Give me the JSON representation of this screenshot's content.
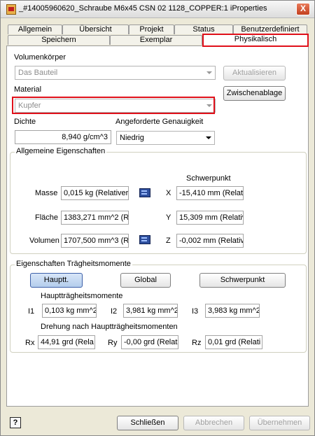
{
  "window": {
    "title": "_#14005960620_Schraube M6x45 CSN 02 1128_COPPER:1 iProperties",
    "close_label": "X"
  },
  "tabs_row1": [
    "Allgemein",
    "Übersicht",
    "Projekt",
    "Status",
    "Benutzerdefiniert"
  ],
  "tabs_row2": [
    "Speichern",
    "Exemplar",
    "Physikalisch"
  ],
  "active_tab": "Physikalisch",
  "volumenkoerper": {
    "label": "Volumenkörper",
    "value": "Das Bauteil"
  },
  "material": {
    "label": "Material",
    "value": "Kupfer"
  },
  "buttons": {
    "aktualisieren": "Aktualisieren",
    "zwischenablage": "Zwischenablage"
  },
  "dichte": {
    "label": "Dichte",
    "value": "8,940 g/cm^3"
  },
  "genauigkeit": {
    "label": "Angeforderte Genauigkeit",
    "value": "Niedrig"
  },
  "allgemein": {
    "title": "Allgemeine Eigenschaften",
    "schwerpunkt_label": "Schwerpunkt",
    "masse_label": "Masse",
    "masse_value": "0,015 kg (Relativer",
    "flaeche_label": "Fläche",
    "flaeche_value": "1383,271 mm^2 (R",
    "volumen_label": "Volumen",
    "volumen_value": "1707,500 mm^3 (R",
    "x_label": "X",
    "x_value": "-15,410 mm (Relati",
    "y_label": "Y",
    "y_value": "15,309 mm (Relativ",
    "z_label": "Z",
    "z_value": "-0,002 mm (Relativ"
  },
  "traegheit": {
    "title": "Eigenschaften Trägheitsmomente",
    "btn_hauptt": "Hauptt.",
    "btn_global": "Global",
    "btn_schwerpunkt": "Schwerpunkt",
    "haupt_label": "Hauptträgheitsmomente",
    "i1_label": "I1",
    "i1_value": "0,103 kg mm^2",
    "i2_label": "I2",
    "i2_value": "3,981 kg mm^2",
    "i3_label": "I3",
    "i3_value": "3,983 kg mm^2",
    "drehung_label": "Drehung nach Hauptträgheitsmomenten",
    "rx_label": "Rx",
    "rx_value": "44,91 grd (Rela",
    "ry_label": "Ry",
    "ry_value": "-0,00 grd (Relat",
    "rz_label": "Rz",
    "rz_value": "0,01 grd (Relati"
  },
  "footer": {
    "schliessen": "Schließen",
    "abbrechen": "Abbrechen",
    "uebernehmen": "Übernehmen",
    "help": "?"
  }
}
